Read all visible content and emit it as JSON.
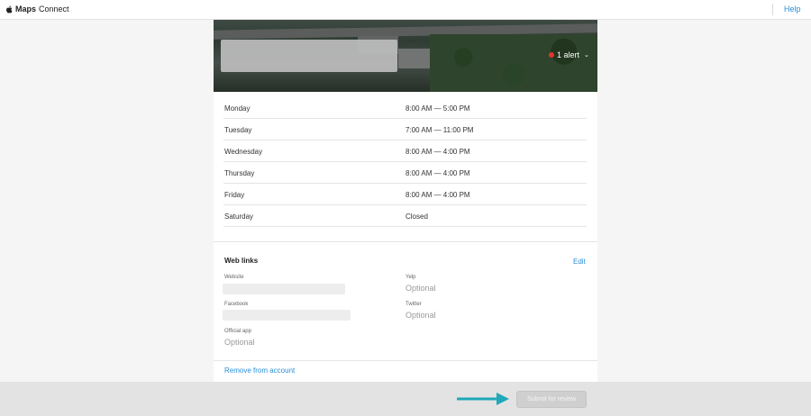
{
  "header": {
    "brand_name": "Maps",
    "brand_suffix": "Connect",
    "help_label": "Help"
  },
  "hero": {
    "alert_label": "1 alert",
    "alert_color": "#e0352b"
  },
  "hours": [
    {
      "day": "Monday",
      "time": "8:00 AM — 5:00 PM"
    },
    {
      "day": "Tuesday",
      "time": "7:00 AM — 11:00 PM"
    },
    {
      "day": "Wednesday",
      "time": "8:00 AM — 4:00 PM"
    },
    {
      "day": "Thursday",
      "time": "8:00 AM — 4:00 PM"
    },
    {
      "day": "Friday",
      "time": "8:00 AM — 4:00 PM"
    },
    {
      "day": "Saturday",
      "time": "Closed"
    }
  ],
  "web_links": {
    "title": "Web links",
    "edit_label": "Edit",
    "website_label": "Website",
    "facebook_label": "Facebook",
    "official_app_label": "Official app",
    "official_app_value": "Optional",
    "yelp_label": "Yelp",
    "yelp_value": "Optional",
    "twitter_label": "Twitter",
    "twitter_value": "Optional"
  },
  "remove_label": "Remove from account",
  "footer": {
    "submit_label": "Submit for review",
    "arrow_color": "#1fa8b8"
  }
}
